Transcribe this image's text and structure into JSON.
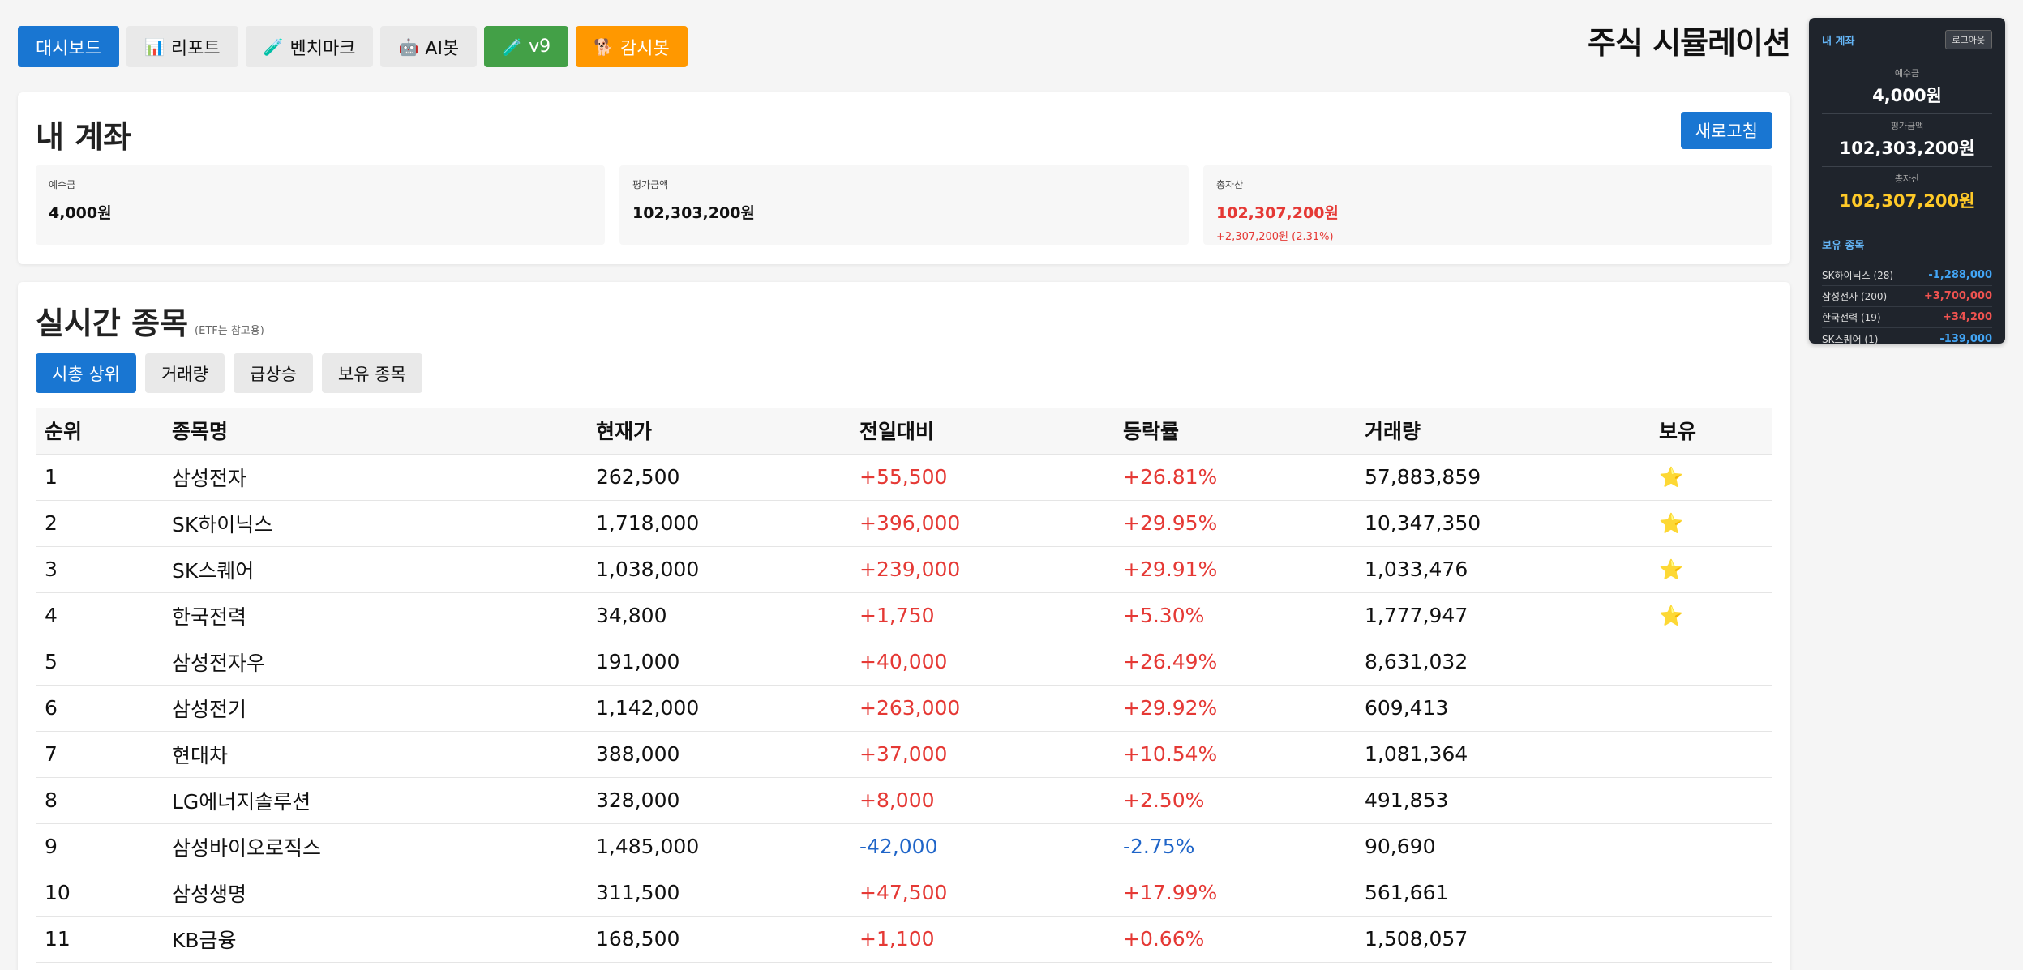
{
  "nav": {
    "buttons": [
      {
        "label": "대시보드",
        "icon": ""
      },
      {
        "label": "리포트",
        "icon": "📊"
      },
      {
        "label": "벤치마크",
        "icon": "🧪"
      },
      {
        "label": "AI봇",
        "icon": "🤖"
      },
      {
        "label": "v9",
        "icon": "🧪"
      },
      {
        "label": "감시봇",
        "icon": "🐕"
      }
    ]
  },
  "app_title": "주식 시뮬레이션",
  "account": {
    "title": "내 계좌",
    "refresh_label": "새로고침",
    "deposit": {
      "label": "예수금",
      "value": "4,000원"
    },
    "evaluation": {
      "label": "평가금액",
      "value": "102,303,200원"
    },
    "total": {
      "label": "총자산",
      "value": "102,307,200원",
      "change": "+2,307,200원 (2.31%)"
    }
  },
  "market": {
    "title": "실시간 종목",
    "note": "(ETF는 참고용)",
    "tabs": [
      "시총 상위",
      "거래량",
      "급상승",
      "보유 종목"
    ],
    "columns": [
      "순위",
      "종목명",
      "현재가",
      "전일대비",
      "등락률",
      "거래량",
      "보유"
    ],
    "rows": [
      {
        "rank": "1",
        "name": "삼성전자",
        "price": "262,500",
        "diff": "+55,500",
        "rate": "+26.81%",
        "volume": "57,883,859",
        "held": "⭐",
        "dir": "up"
      },
      {
        "rank": "2",
        "name": "SK하이닉스",
        "price": "1,718,000",
        "diff": "+396,000",
        "rate": "+29.95%",
        "volume": "10,347,350",
        "held": "⭐",
        "dir": "up"
      },
      {
        "rank": "3",
        "name": "SK스퀘어",
        "price": "1,038,000",
        "diff": "+239,000",
        "rate": "+29.91%",
        "volume": "1,033,476",
        "held": "⭐",
        "dir": "up"
      },
      {
        "rank": "4",
        "name": "한국전력",
        "price": "34,800",
        "diff": "+1,750",
        "rate": "+5.30%",
        "volume": "1,777,947",
        "held": "⭐",
        "dir": "up"
      },
      {
        "rank": "5",
        "name": "삼성전자우",
        "price": "191,000",
        "diff": "+40,000",
        "rate": "+26.49%",
        "volume": "8,631,032",
        "held": "",
        "dir": "up"
      },
      {
        "rank": "6",
        "name": "삼성전기",
        "price": "1,142,000",
        "diff": "+263,000",
        "rate": "+29.92%",
        "volume": "609,413",
        "held": "",
        "dir": "up"
      },
      {
        "rank": "7",
        "name": "현대차",
        "price": "388,000",
        "diff": "+37,000",
        "rate": "+10.54%",
        "volume": "1,081,364",
        "held": "",
        "dir": "up"
      },
      {
        "rank": "8",
        "name": "LG에너지솔루션",
        "price": "328,000",
        "diff": "+8,000",
        "rate": "+2.50%",
        "volume": "491,853",
        "held": "",
        "dir": "up"
      },
      {
        "rank": "9",
        "name": "삼성바이오로직스",
        "price": "1,485,000",
        "diff": "-42,000",
        "rate": "-2.75%",
        "volume": "90,690",
        "held": "",
        "dir": "down"
      },
      {
        "rank": "10",
        "name": "삼성생명",
        "price": "311,500",
        "diff": "+47,500",
        "rate": "+17.99%",
        "volume": "561,661",
        "held": "",
        "dir": "up"
      },
      {
        "rank": "11",
        "name": "KB금융",
        "price": "168,500",
        "diff": "+1,100",
        "rate": "+0.66%",
        "volume": "1,508,057",
        "held": "",
        "dir": "up"
      }
    ]
  },
  "side": {
    "title": "내 계좌",
    "logout_label": "로그아웃",
    "deposit": {
      "label": "예수금",
      "value": "4,000원"
    },
    "evaluation": {
      "label": "평가금액",
      "value": "102,303,200원"
    },
    "total": {
      "label": "총자산",
      "value": "102,307,200원"
    },
    "holdings_title": "보유 종목",
    "holdings": [
      {
        "name": "SK하이닉스 (28)",
        "pl": "-1,288,000",
        "dir": "down"
      },
      {
        "name": "삼성전자 (200)",
        "pl": "+3,700,000",
        "dir": "up"
      },
      {
        "name": "한국전력 (19)",
        "pl": "+34,200",
        "dir": "up"
      },
      {
        "name": "SK스퀘어 (1)",
        "pl": "-139,000",
        "dir": "down"
      }
    ]
  },
  "colors": {
    "primary": "#1976d2",
    "green": "#43a047",
    "orange": "#ff9800",
    "up": "#e53935",
    "down": "#1e64c8",
    "panel": "#1f242c",
    "gold": "#ffca28"
  }
}
